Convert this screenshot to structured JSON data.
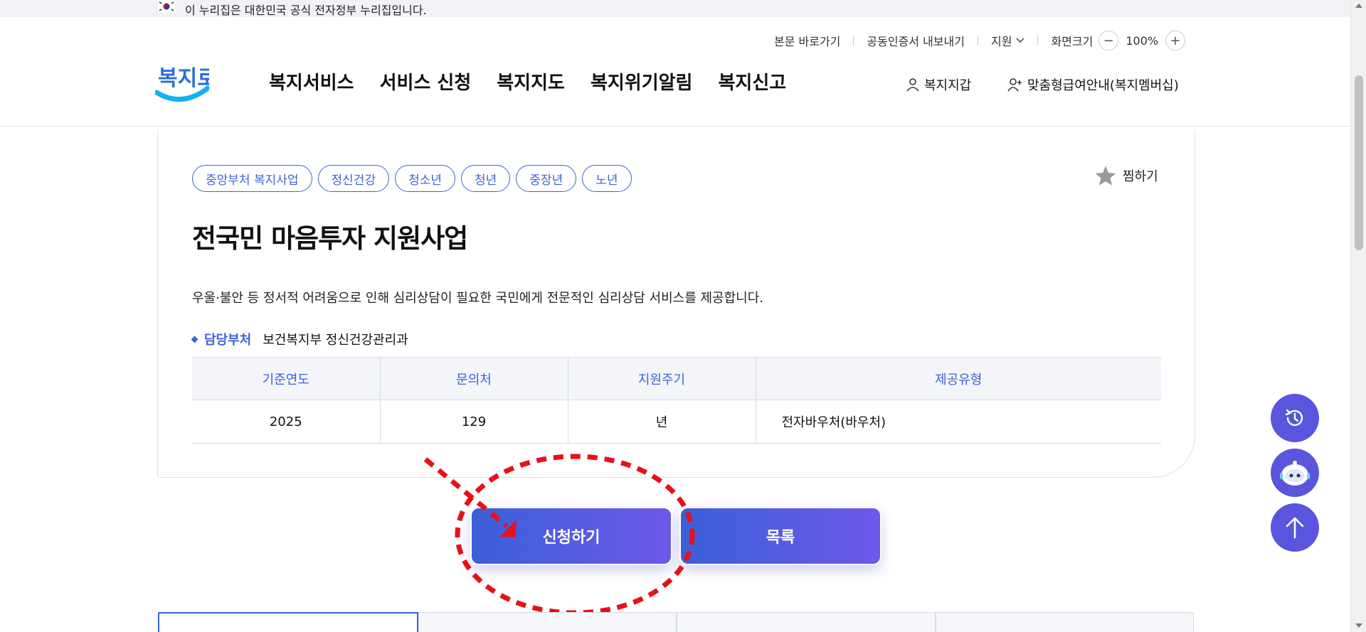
{
  "gov_banner": {
    "text": "이 누리집은 대한민국 공식 전자정부 누리집입니다."
  },
  "utility": {
    "skip_link": "본문 바로가기",
    "cert_export": "공동인증서 내보내기",
    "support": "지원",
    "zoom_label": "화면크기",
    "zoom_minus": "−",
    "zoom_value": "100%",
    "zoom_plus": "+"
  },
  "header": {
    "logo_text": "복지로",
    "nav": [
      "복지서비스",
      "서비스 신청",
      "복지지도",
      "복지위기알림",
      "복지신고"
    ],
    "wallet": "복지지갑",
    "membership": "맞춤형급여안내(복지멤버십)"
  },
  "service": {
    "tags": [
      "중앙부처 복지사업",
      "정신건강",
      "청소년",
      "청년",
      "중장년",
      "노년"
    ],
    "favorite": "찜하기",
    "title": "전국민 마음투자 지원사업",
    "description": "우울·불안 등 정서적 어려움으로 인해 심리상담이 필요한 국민에게 전문적인 심리상담 서비스를 제공합니다.",
    "dept_label": "담당부처",
    "dept_value": "보건복지부 정신건강관리과",
    "table": {
      "headers": [
        "기준연도",
        "문의처",
        "지원주기",
        "제공유형"
      ],
      "row": [
        "2025",
        "129",
        "년",
        "전자바우처(바우처)"
      ]
    }
  },
  "actions": {
    "apply": "신청하기",
    "list": "목록"
  },
  "colors": {
    "accent": "#3d63d6",
    "button_start": "#3b5fd8",
    "button_end": "#6e58ea",
    "fab": "#5a55dd",
    "annotation": "#e8101a"
  },
  "fabs": [
    "history-icon",
    "chatbot-icon",
    "arrow-up-icon"
  ]
}
